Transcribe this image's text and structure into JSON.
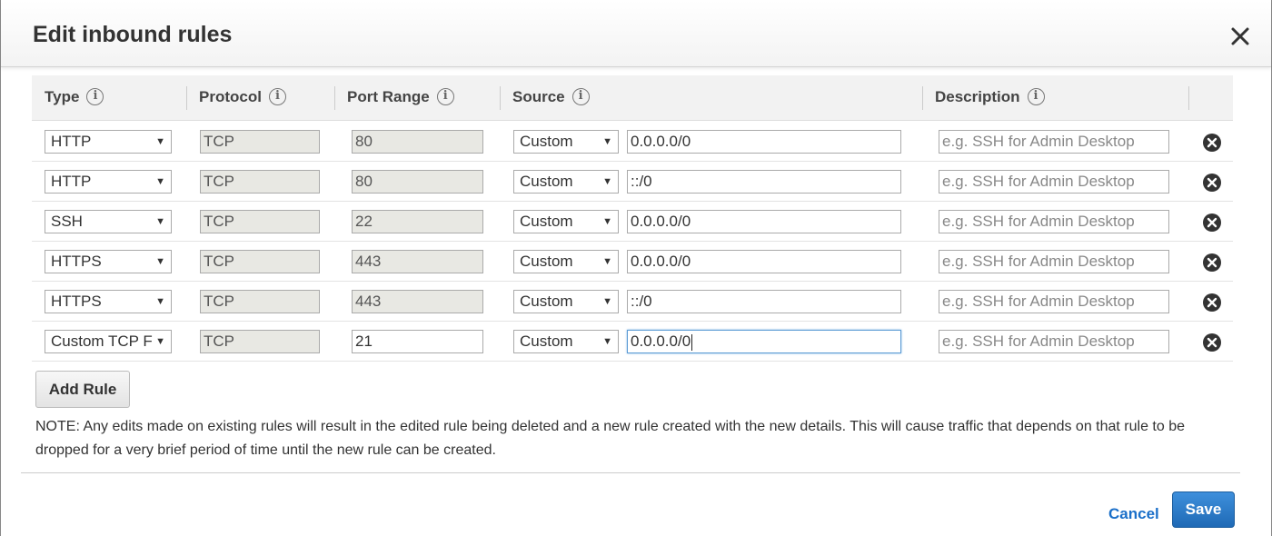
{
  "dialog": {
    "title": "Edit inbound rules",
    "close_icon": "close-icon"
  },
  "columns": {
    "type": "Type",
    "protocol": "Protocol",
    "port_range": "Port Range",
    "source": "Source",
    "description": "Description",
    "info_icon": "i"
  },
  "rules": [
    {
      "type": "HTTP",
      "protocol": "TCP",
      "port": "80",
      "source_type": "Custom",
      "source": "0.0.0.0/0",
      "description_placeholder": "e.g. SSH for Admin Desktop"
    },
    {
      "type": "HTTP",
      "protocol": "TCP",
      "port": "80",
      "source_type": "Custom",
      "source": "::/0",
      "description_placeholder": "e.g. SSH for Admin Desktop"
    },
    {
      "type": "SSH",
      "protocol": "TCP",
      "port": "22",
      "source_type": "Custom",
      "source": "0.0.0.0/0",
      "description_placeholder": "e.g. SSH for Admin Desktop"
    },
    {
      "type": "HTTPS",
      "protocol": "TCP",
      "port": "443",
      "source_type": "Custom",
      "source": "0.0.0.0/0",
      "description_placeholder": "e.g. SSH for Admin Desktop"
    },
    {
      "type": "HTTPS",
      "protocol": "TCP",
      "port": "443",
      "source_type": "Custom",
      "source": "::/0",
      "description_placeholder": "e.g. SSH for Admin Desktop"
    },
    {
      "type": "Custom TCP F",
      "protocol": "TCP",
      "port": "21",
      "source_type": "Custom",
      "source": "0.0.0.0/0",
      "description_placeholder": "e.g. SSH for Admin Desktop"
    }
  ],
  "add_rule_label": "Add Rule",
  "note": "NOTE: Any edits made on existing rules will result in the edited rule being deleted and a new rule created with the new details. This will cause traffic that depends on that rule to be dropped for a very brief period of time until the new rule can be created.",
  "footer": {
    "cancel_label": "Cancel",
    "save_label": "Save"
  },
  "colors": {
    "primary_button": "#1f6ab6",
    "link": "#1a6fc9",
    "disabled_field": "#e8e8e3"
  }
}
